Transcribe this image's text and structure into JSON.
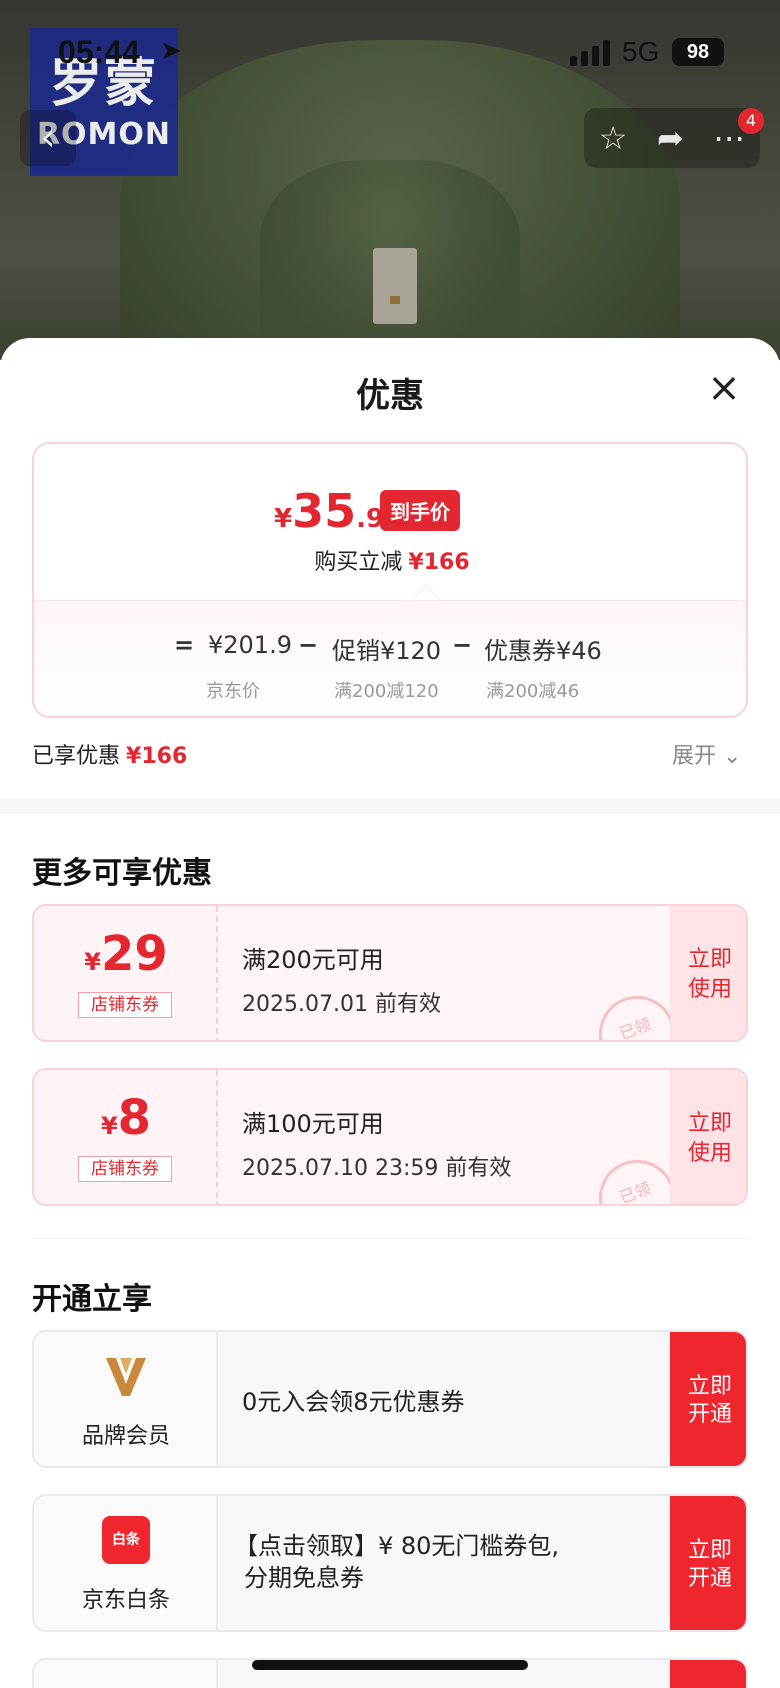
{
  "status_bar": {
    "time": "05:44",
    "network": "5G",
    "battery": "98"
  },
  "brand": {
    "cn": "罗蒙",
    "en": "ROMON"
  },
  "nav": {
    "back": "‹",
    "cart_badge": "4"
  },
  "sheet": {
    "title": "优惠",
    "close": "×",
    "final_price": {
      "symbol": "¥",
      "integer": "35",
      "decimal": ".9",
      "tag": "到手价"
    },
    "reduce_label": "购买立减",
    "reduce_amount": "¥166",
    "breakdown": {
      "eq": "=",
      "base_price": "¥201.9",
      "base_label": "京东价",
      "minus1": "−",
      "promo": "促销¥120",
      "promo_rule": "满200减120",
      "minus2": "−",
      "coupon": "优惠券¥46",
      "coupon_rule": "满200减46"
    },
    "enjoyed_label": "已享优惠",
    "enjoyed_amount": "¥166",
    "expand_label": "展开",
    "more_title": "更多可享优惠",
    "coupons": [
      {
        "symbol": "¥",
        "amount": "29",
        "type": "店铺东券",
        "condition": "满200元可用",
        "valid": "2025.07.01 前有效",
        "action": "立即使用",
        "stamp": "已领"
      },
      {
        "symbol": "¥",
        "amount": "8",
        "type": "店铺东券",
        "condition": "满100元可用",
        "valid": "2025.07.10 23:59 前有效",
        "action": "立即使用",
        "stamp": "已领"
      }
    ],
    "open_title": "开通立享",
    "memberships": [
      {
        "label": "品牌会员",
        "desc": "0元入会领8元优惠券",
        "action": "立即开通"
      },
      {
        "label": "京东白条",
        "logo_text": "白条",
        "desc_line1": "【点击领取】¥ 80无门槛券包,",
        "desc_line2": "分期免息券",
        "action": "立即开通"
      }
    ]
  },
  "colors": {
    "accent": "#e3262f",
    "coupon_bg": "#fff5f6",
    "member_bg": "#f8f8fa"
  }
}
